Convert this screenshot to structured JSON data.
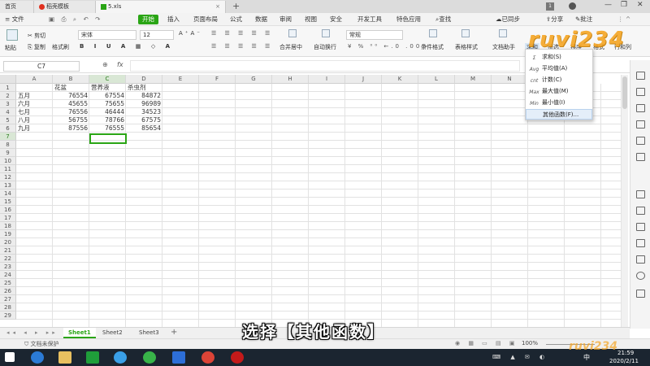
{
  "window_tabs": [
    {
      "label": "首页",
      "active": false
    },
    {
      "label": "稻壳模板",
      "active": false
    },
    {
      "label": "5.xls",
      "active": true
    }
  ],
  "menu": {
    "file": "文件",
    "items": [
      "开始",
      "插入",
      "页面布局",
      "公式",
      "数据",
      "审阅",
      "视图",
      "安全",
      "开发工具",
      "特色应用"
    ],
    "active": "开始",
    "search": "查找",
    "sync": "已同步",
    "share": "分享",
    "comment": "批注"
  },
  "ribbon": {
    "cut": "剪切",
    "paste": "粘贴",
    "copy": "复制",
    "format_painter": "格式刷",
    "font_name": "宋体",
    "font_size": "12",
    "merge_center": "合并居中",
    "wrap_text": "自动换行",
    "number_format": "常规",
    "conditional_format": "条件格式",
    "table_style": "表格样式",
    "doc_helper": "文档助手",
    "sum": "求和",
    "filter": "筛选",
    "sort": "排序",
    "format": "格式",
    "row_col": "行和列"
  },
  "formula_bar": {
    "name_box": "C7",
    "fx": "fx"
  },
  "columns": [
    "A",
    "B",
    "C",
    "D",
    "E",
    "F",
    "G",
    "H",
    "I",
    "J",
    "K",
    "L",
    "M",
    "N"
  ],
  "row_count": 29,
  "selected_cell": {
    "col": "C",
    "row": 7
  },
  "table": {
    "headers": [
      "",
      "花盆",
      "营养液",
      "杀虫剂"
    ],
    "rows": [
      [
        "五月",
        "76554",
        "67554",
        "84872"
      ],
      [
        "六月",
        "45655",
        "75655",
        "96989"
      ],
      [
        "七月",
        "76556",
        "46444",
        "34523"
      ],
      [
        "八月",
        "56755",
        "78766",
        "67575"
      ],
      [
        "九月",
        "87556",
        "76555",
        "85654"
      ]
    ]
  },
  "sum_dropdown": {
    "items": [
      {
        "icon": "Σ",
        "label": "求和(S)"
      },
      {
        "icon": "Avg",
        "label": "平均值(A)"
      },
      {
        "icon": "cnt",
        "label": "计数(C)"
      },
      {
        "icon": "Max",
        "label": "最大值(M)"
      },
      {
        "icon": "Min",
        "label": "最小值(I)"
      },
      {
        "icon": "",
        "label": "其他函数(F)..."
      }
    ],
    "highlighted_index": 5
  },
  "sheets": [
    {
      "label": "Sheet1",
      "active": true
    },
    {
      "label": "Sheet2",
      "active": false
    },
    {
      "label": "Sheet3",
      "active": false
    }
  ],
  "status": {
    "protect": "文档未保护",
    "zoom": "100%"
  },
  "caption": "选择【其他函数】",
  "watermark": "ruvi234",
  "taskbar": {
    "time": "21:59",
    "date": "2020/2/11",
    "ime": "中"
  },
  "colors": {
    "accent": "#2aa515",
    "taskbar": "#1b2530"
  }
}
